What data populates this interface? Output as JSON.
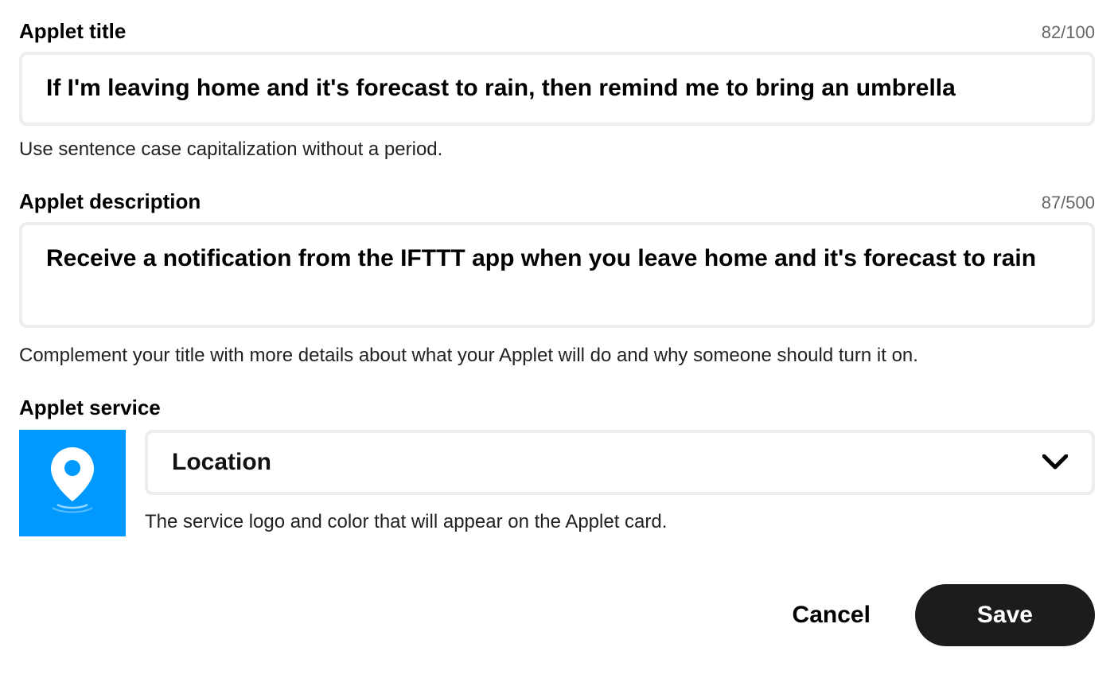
{
  "title_section": {
    "label": "Applet title",
    "counter": "82/100",
    "value": "If I'm leaving home and it's forecast to rain, then remind me to bring an umbrella",
    "help": "Use sentence case capitalization without a period."
  },
  "description_section": {
    "label": "Applet description",
    "counter": "87/500",
    "value": "Receive a notification from the IFTTT app when you leave home and it's forecast to rain",
    "help": "Complement your title with more details about what your Applet will do and why someone should turn it on."
  },
  "service_section": {
    "label": "Applet service",
    "selected": "Location",
    "help": "The service logo and color that will appear on the Applet card.",
    "icon_color": "#0099ff"
  },
  "buttons": {
    "cancel": "Cancel",
    "save": "Save"
  }
}
